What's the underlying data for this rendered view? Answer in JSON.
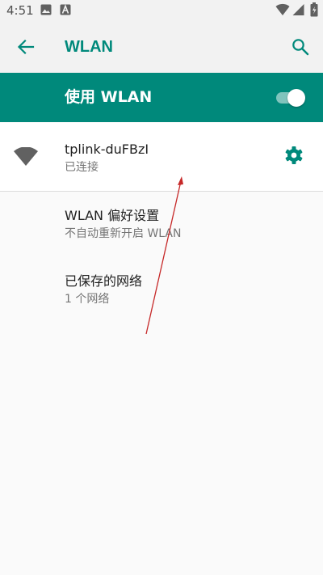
{
  "status_bar": {
    "time": "4:51",
    "icons": [
      "image-icon",
      "a-notification-icon",
      "wifi-signal-icon",
      "cell-signal-icon",
      "battery-icon"
    ]
  },
  "toolbar": {
    "title": "WLAN",
    "back_icon": "back-arrow-icon",
    "search_icon": "search-icon"
  },
  "master_switch": {
    "label": "使用 WLAN",
    "enabled": true
  },
  "connected_network": {
    "name": "tplink-duFBzI",
    "status": "已连接",
    "icon": "wifi-icon",
    "settings_icon": "gear-icon"
  },
  "preferences": [
    {
      "title": "WLAN 偏好设置",
      "summary": "不自动重新开启 WLAN"
    },
    {
      "title": "已保存的网络",
      "summary": "1 个网络"
    }
  ],
  "colors": {
    "accent": "#00897b",
    "bar_background": "#f2f2f2",
    "background": "#fafafa",
    "annotation_arrow": "#c62828"
  }
}
